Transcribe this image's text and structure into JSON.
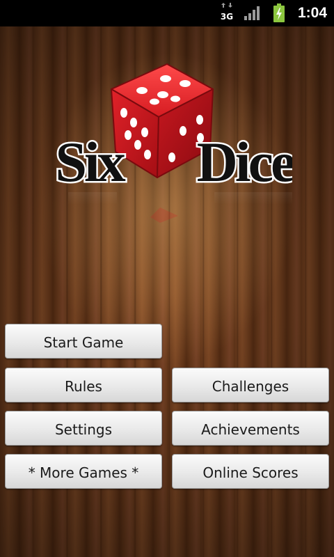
{
  "status_bar": {
    "network": "3G",
    "time": "1:04",
    "icons": [
      "network-3g-icon",
      "signal-icon",
      "battery-charging-icon"
    ]
  },
  "logo": {
    "word_left": "Six",
    "word_right": "Dice"
  },
  "menu": {
    "start_game": "Start Game",
    "rules": "Rules",
    "challenges": "Challenges",
    "settings": "Settings",
    "achievements": "Achievements",
    "more_games": "* More Games *",
    "online_scores": "Online Scores"
  },
  "colors": {
    "die_red": "#c8141a",
    "wood": "#7a4421",
    "battery_green": "#8cc63f"
  }
}
